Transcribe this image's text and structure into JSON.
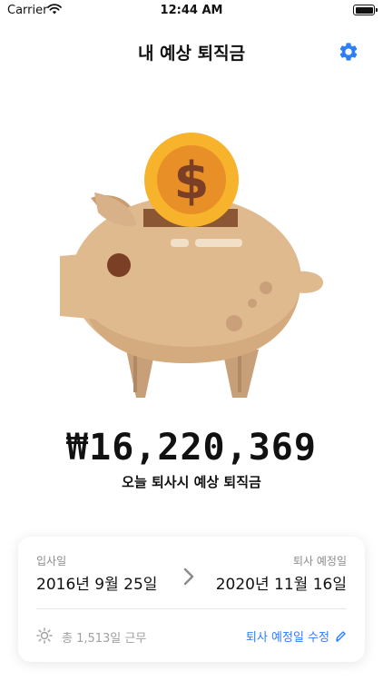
{
  "status_bar": {
    "carrier": "Carrier",
    "time": "12:44 AM"
  },
  "header": {
    "title": "내 예상 퇴직금",
    "settings_icon": "gear-icon"
  },
  "illustration": {
    "icon": "piggy-bank-coin-icon"
  },
  "summary": {
    "amount": "₩16,220,369",
    "caption": "오늘 퇴사시 예상 퇴직금"
  },
  "card": {
    "start_label": "입사일",
    "start_date": "2016년 9월 25일",
    "end_label": "퇴사 예정일",
    "end_date": "2020년 11월 16일",
    "worked_text": "총 1,513일 근무",
    "edit_label": "퇴사 예정일 수정"
  },
  "colors": {
    "accent": "#2d7ff9",
    "coin": "#f7b32b",
    "pig": "#e0bd92"
  }
}
